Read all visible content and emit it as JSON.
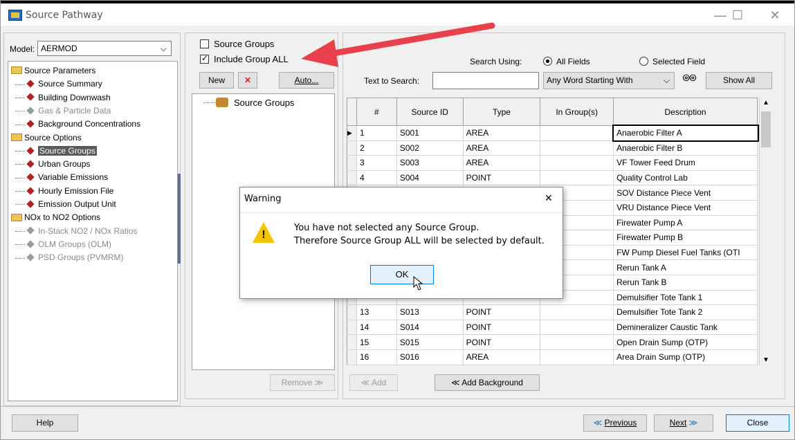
{
  "window": {
    "title": "Source Pathway",
    "minimize": "—",
    "maximize": "☐",
    "close": "✕"
  },
  "model": {
    "label": "Model:",
    "value": "AERMOD"
  },
  "tree": {
    "items": [
      {
        "label": "Source Parameters",
        "kind": "folder"
      },
      {
        "label": "Source Summary",
        "kind": "item"
      },
      {
        "label": "Building Downwash",
        "kind": "item"
      },
      {
        "label": "Gas & Particle Data",
        "kind": "item-gray"
      },
      {
        "label": "Background Concentrations",
        "kind": "item"
      },
      {
        "label": "Source Options",
        "kind": "folder"
      },
      {
        "label": "Source Groups",
        "kind": "item-selected"
      },
      {
        "label": "Urban Groups",
        "kind": "item"
      },
      {
        "label": "Variable Emissions",
        "kind": "item"
      },
      {
        "label": "Hourly Emission File",
        "kind": "item"
      },
      {
        "label": "Emission Output Unit",
        "kind": "item"
      },
      {
        "label": "NOx to NO2 Options",
        "kind": "folder"
      },
      {
        "label": "In-Stack NO2 / NOx Ratios",
        "kind": "item-gray"
      },
      {
        "label": "OLM Groups (OLM)",
        "kind": "item-gray"
      },
      {
        "label": "PSD Groups (PVMRM)",
        "kind": "item-gray"
      }
    ]
  },
  "groups": {
    "source_groups_label": "Source Groups",
    "include_all_label": "Include Group ALL",
    "new_label": "New",
    "delete_symbol": "✕",
    "auto_label": "Auto...",
    "tree_root": "Source Groups",
    "remove_label": "Remove ≫"
  },
  "search": {
    "search_using_label": "Search Using:",
    "all_fields": "All Fields",
    "selected_field": "Selected Field",
    "text_label": "Text to Search:",
    "text_value": "",
    "mode_value": "Any Word Starting With",
    "show_all": "Show All"
  },
  "table": {
    "headers": [
      "#",
      "Source ID",
      "Type",
      "In Group(s)",
      "Description"
    ],
    "rows": [
      [
        "1",
        "S001",
        "AREA",
        "",
        "Anaerobic Filter A"
      ],
      [
        "2",
        "S002",
        "AREA",
        "",
        "Anaerobic Filter B"
      ],
      [
        "3",
        "S003",
        "AREA",
        "",
        "VF Tower Feed Drum"
      ],
      [
        "4",
        "S004",
        "POINT",
        "",
        "Quality Control Lab"
      ],
      [
        "",
        "",
        "",
        "",
        "SOV Distance Piece Vent"
      ],
      [
        "",
        "",
        "",
        "",
        "VRU Distance Piece Vent"
      ],
      [
        "",
        "",
        "",
        "",
        "Firewater Pump A"
      ],
      [
        "",
        "",
        "",
        "",
        "Firewater Pump B"
      ],
      [
        "",
        "",
        "",
        "",
        "FW Pump Diesel Fuel Tanks (OTI"
      ],
      [
        "",
        "",
        "",
        "",
        "Rerun Tank A"
      ],
      [
        "",
        "",
        "",
        "",
        "Rerun Tank B"
      ],
      [
        "",
        "",
        "",
        "",
        "Demulsifier Tote Tank 1"
      ],
      [
        "13",
        "S013",
        "POINT",
        "",
        "Demulsifier Tote Tank 2"
      ],
      [
        "14",
        "S014",
        "POINT",
        "",
        "Demineralizer Caustic Tank"
      ],
      [
        "15",
        "S015",
        "POINT",
        "",
        "Open Drain Sump (OTP)"
      ],
      [
        "16",
        "S016",
        "AREA",
        "",
        "Area Drain Sump (OTP)"
      ]
    ]
  },
  "bottom": {
    "add_label": "≪ Add",
    "add_background_label": "≪  Add Background",
    "help": "Help",
    "previous": "Previous",
    "next": "Next",
    "close": "Close"
  },
  "dialog": {
    "title": "Warning",
    "line1": "You have not selected any Source Group.",
    "line2": "Therefore Source Group ALL will be selected by default.",
    "ok": "OK",
    "close": "✕"
  },
  "colors": {
    "arrow": "#e8414b",
    "selection": "#5a5a5a",
    "focus": "#0078d7"
  }
}
